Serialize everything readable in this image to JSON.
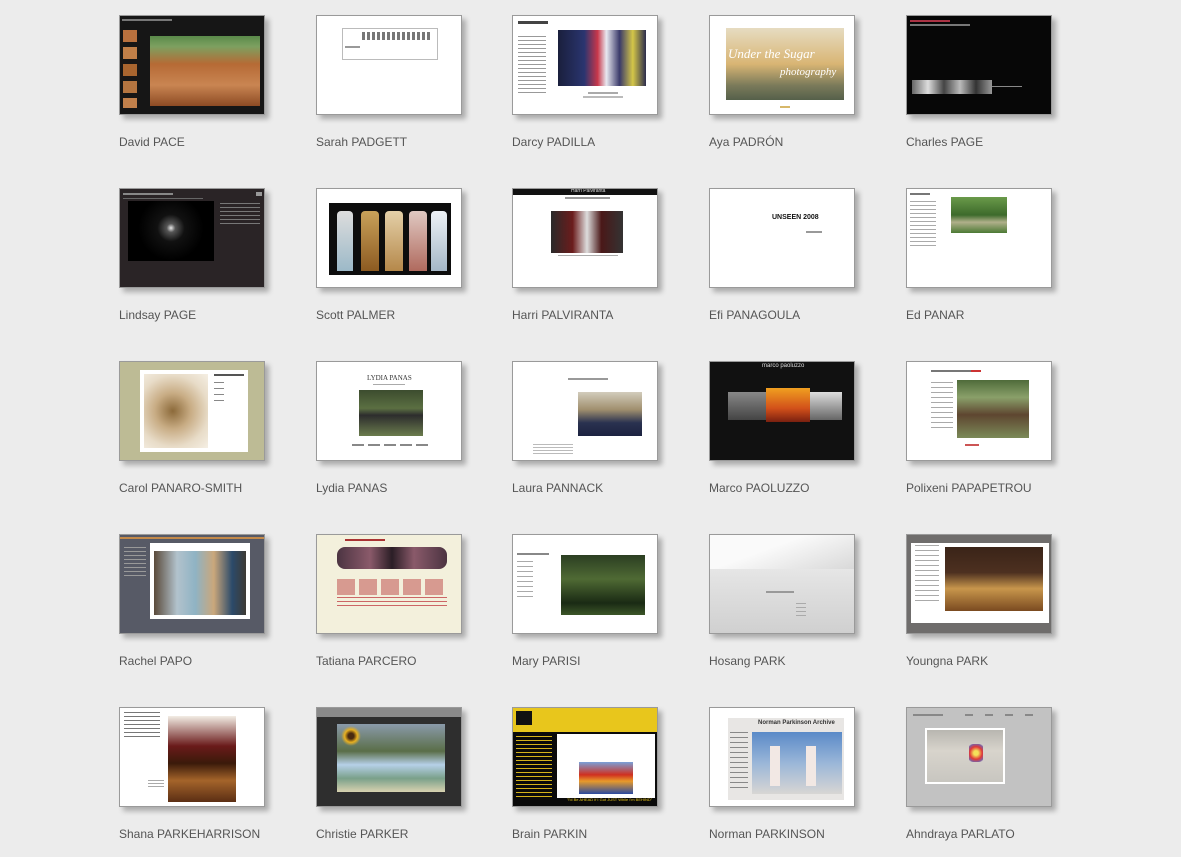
{
  "photographers": [
    {
      "name": "David PACE"
    },
    {
      "name": "Sarah PADGETT"
    },
    {
      "name": "Darcy PADILLA"
    },
    {
      "name": "Aya PADRÓN"
    },
    {
      "name": "Charles PAGE"
    },
    {
      "name": "Lindsay PAGE"
    },
    {
      "name": "Scott PALMER"
    },
    {
      "name": "Harri PALVIRANTA"
    },
    {
      "name": "Efi PANAGOULA"
    },
    {
      "name": "Ed PANAR"
    },
    {
      "name": "Carol PANARO-SMITH"
    },
    {
      "name": "Lydia PANAS"
    },
    {
      "name": "Laura PANNACK"
    },
    {
      "name": "Marco PAOLUZZO"
    },
    {
      "name": "Polixeni PAPAPETROU"
    },
    {
      "name": "Rachel PAPO"
    },
    {
      "name": "Tatiana PARCERO"
    },
    {
      "name": "Mary PARISI"
    },
    {
      "name": "Hosang PARK"
    },
    {
      "name": "Youngna PARK"
    },
    {
      "name": "Shana PARKEHARRISON"
    },
    {
      "name": "Christie PARKER"
    },
    {
      "name": "Brain PARKIN"
    },
    {
      "name": "Norman PARKINSON"
    },
    {
      "name": "Ahndraya PARLATO"
    }
  ],
  "thumb_text": {
    "aya_script": "Under the Sugar",
    "aya_script2": "photography",
    "marco_title": "marco paoluzzo",
    "efi_title": "UNSEEN 2008",
    "lydia_title": "LYDIA PANAS",
    "norman_title": "Norman Parkinson Archive",
    "brain_footer": "\"I'd Be AHEAD if I Got JUST While I'm BEHIND\"",
    "harri_title": "Harri Palviranta"
  }
}
